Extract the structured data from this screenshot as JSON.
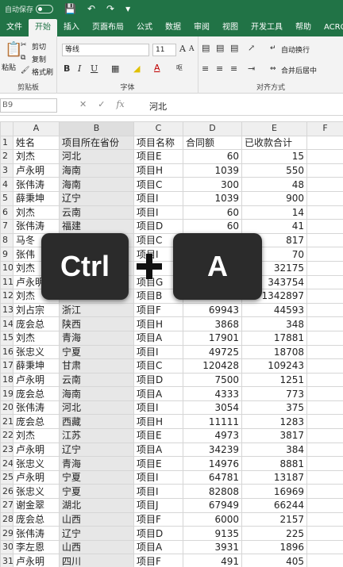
{
  "titlebar": {
    "autosave_label": "自动保存",
    "toggle_state": "关"
  },
  "tabs": [
    "文件",
    "开始",
    "插入",
    "页面布局",
    "公式",
    "数据",
    "审阅",
    "视图",
    "开发工具",
    "帮助",
    "ACROB"
  ],
  "active_tab": "开始",
  "ribbon": {
    "paste_label": "粘贴",
    "cut_label": "剪切",
    "copy_label": "复制",
    "format_painter_label": "格式刷",
    "clipboard_group": "剪贴板",
    "font_name": "等线",
    "font_size": "11",
    "font_group": "字体",
    "wrap_label": "自动换行",
    "merge_label": "合并后居中",
    "align_group": "对齐方式"
  },
  "formula_bar": {
    "name_box": "B9",
    "value": "河北"
  },
  "columns": [
    "A",
    "B",
    "C",
    "D",
    "E",
    "F"
  ],
  "rows": [
    {
      "n": "1",
      "a": "姓名",
      "b": "项目所在省份",
      "c": "项目名称",
      "d": "合同额",
      "e": "已收款合计"
    },
    {
      "n": "2",
      "a": "刘杰",
      "b": "河北",
      "c": "项目E",
      "d": "60",
      "e": "15"
    },
    {
      "n": "3",
      "a": "卢永明",
      "b": "海南",
      "c": "项目H",
      "d": "1039",
      "e": "550"
    },
    {
      "n": "4",
      "a": "张伟涛",
      "b": "海南",
      "c": "项目C",
      "d": "300",
      "e": "48"
    },
    {
      "n": "5",
      "a": "薛秉坤",
      "b": "辽宁",
      "c": "项目I",
      "d": "1039",
      "e": "900"
    },
    {
      "n": "6",
      "a": "刘杰",
      "b": "云南",
      "c": "项目I",
      "d": "60",
      "e": "14"
    },
    {
      "n": "7",
      "a": "张伟涛",
      "b": "福建",
      "c": "项目D",
      "d": "60",
      "e": "41"
    },
    {
      "n": "8",
      "a": "马冬",
      "b": "",
      "c": "项目C",
      "d": "",
      "e": "817"
    },
    {
      "n": "9",
      "a": "张伟",
      "b": "",
      "c": "项目I",
      "d": "",
      "e": "70"
    },
    {
      "n": "10",
      "a": "刘杰",
      "b": "",
      "c": "",
      "d": "",
      "e": "32175"
    },
    {
      "n": "11",
      "a": "卢永明",
      "b": "",
      "c": "项目G",
      "d": "",
      "e": "343754"
    },
    {
      "n": "12",
      "a": "刘杰",
      "b": "",
      "c": "项目B",
      "d": "",
      "e": "1342897"
    },
    {
      "n": "13",
      "a": "刘占宗",
      "b": "浙江",
      "c": "项目F",
      "d": "69943",
      "e": "44593"
    },
    {
      "n": "14",
      "a": "庞会总",
      "b": "陕西",
      "c": "项目H",
      "d": "3868",
      "e": "348"
    },
    {
      "n": "15",
      "a": "刘杰",
      "b": "青海",
      "c": "项目A",
      "d": "17901",
      "e": "17881"
    },
    {
      "n": "16",
      "a": "张忠义",
      "b": "宁夏",
      "c": "项目I",
      "d": "49725",
      "e": "18708"
    },
    {
      "n": "17",
      "a": "薛秉坤",
      "b": "甘肃",
      "c": "项目C",
      "d": "120428",
      "e": "109243"
    },
    {
      "n": "18",
      "a": "卢永明",
      "b": "云南",
      "c": "项目D",
      "d": "7500",
      "e": "1251"
    },
    {
      "n": "19",
      "a": "庞会总",
      "b": "海南",
      "c": "项目A",
      "d": "4333",
      "e": "773"
    },
    {
      "n": "20",
      "a": "张伟涛",
      "b": "河北",
      "c": "项目I",
      "d": "3054",
      "e": "375"
    },
    {
      "n": "21",
      "a": "庞会总",
      "b": "西藏",
      "c": "项目H",
      "d": "11111",
      "e": "1283"
    },
    {
      "n": "22",
      "a": "刘杰",
      "b": "江苏",
      "c": "项目E",
      "d": "4973",
      "e": "3817"
    },
    {
      "n": "23",
      "a": "卢永明",
      "b": "辽宁",
      "c": "项目A",
      "d": "34239",
      "e": "384"
    },
    {
      "n": "24",
      "a": "张忠义",
      "b": "青海",
      "c": "项目E",
      "d": "14976",
      "e": "8881"
    },
    {
      "n": "25",
      "a": "卢永明",
      "b": "宁夏",
      "c": "项目I",
      "d": "64781",
      "e": "13187"
    },
    {
      "n": "26",
      "a": "张忠义",
      "b": "宁夏",
      "c": "项目I",
      "d": "82808",
      "e": "16969"
    },
    {
      "n": "27",
      "a": "谢金翠",
      "b": "湖北",
      "c": "项目J",
      "d": "67949",
      "e": "66244"
    },
    {
      "n": "28",
      "a": "庞会总",
      "b": "山西",
      "c": "项目F",
      "d": "6000",
      "e": "2157"
    },
    {
      "n": "29",
      "a": "张伟涛",
      "b": "辽宁",
      "c": "项目D",
      "d": "9135",
      "e": "225"
    },
    {
      "n": "30",
      "a": "李左恩",
      "b": "山西",
      "c": "项目A",
      "d": "3931",
      "e": "1896"
    },
    {
      "n": "31",
      "a": "卢永明",
      "b": "四川",
      "c": "项目F",
      "d": "491",
      "e": "405"
    }
  ],
  "overlay": {
    "key1": "Ctrl",
    "key2": "A"
  }
}
